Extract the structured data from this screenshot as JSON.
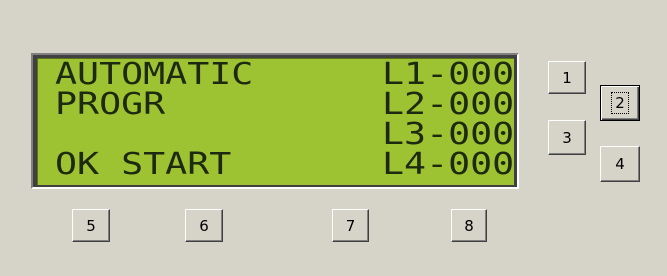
{
  "lcd": {
    "rows": [
      {
        "left": "AUTOMATIC",
        "right": "L1-000"
      },
      {
        "left": "PROGR",
        "right": "L2-000"
      },
      {
        "left": "",
        "right": "L3-000"
      },
      {
        "left": "OK START",
        "right": "L4-000"
      }
    ]
  },
  "buttons": {
    "b1": "1",
    "b2": "2",
    "b3": "3",
    "b4": "4",
    "b5": "5",
    "b6": "6",
    "b7": "7",
    "b8": "8"
  },
  "focused_button": "2"
}
